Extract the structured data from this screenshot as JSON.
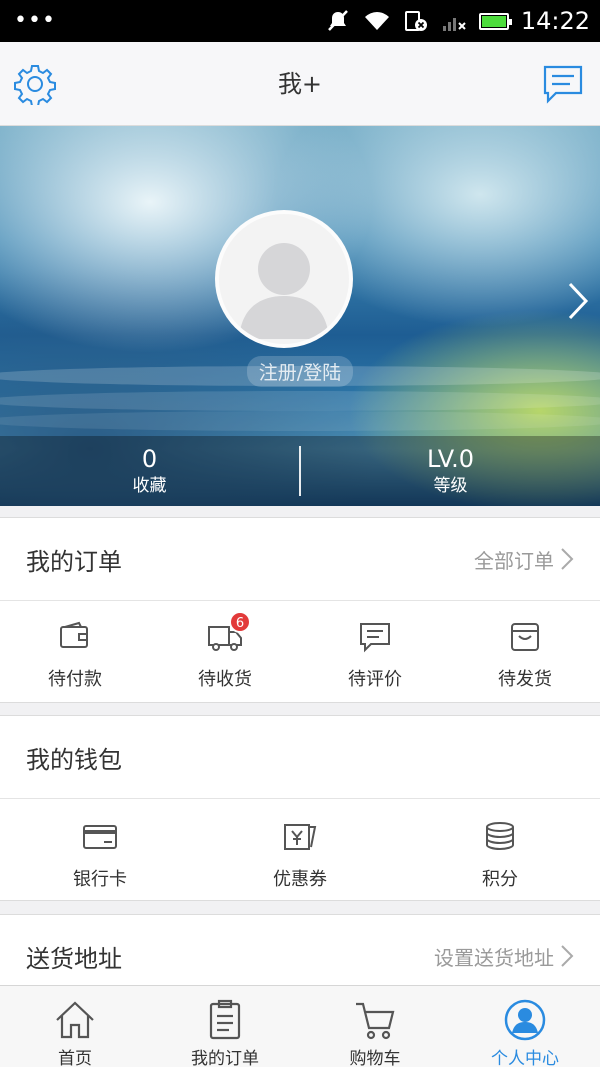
{
  "status_bar": {
    "time": "14:22",
    "dots": "•••"
  },
  "header": {
    "title": "我+"
  },
  "profile": {
    "login_label": "注册/登陆",
    "stats": [
      {
        "value": "0",
        "label": "收藏"
      },
      {
        "value": "LV.0",
        "label": "等级"
      }
    ]
  },
  "orders": {
    "title": "我的订单",
    "more": "全部订单",
    "items": [
      {
        "label": "待付款",
        "icon": "wallet-icon"
      },
      {
        "label": "待收货",
        "icon": "truck-icon",
        "badge": "6"
      },
      {
        "label": "待评价",
        "icon": "comment-icon"
      },
      {
        "label": "待发货",
        "icon": "box-icon"
      }
    ]
  },
  "wallet": {
    "title": "我的钱包",
    "items": [
      {
        "label": "银行卡",
        "icon": "bank-card-icon"
      },
      {
        "label": "优惠券",
        "icon": "coupon-icon"
      },
      {
        "label": "积分",
        "icon": "coins-icon"
      }
    ]
  },
  "address": {
    "title": "送货地址",
    "more": "设置送货地址"
  },
  "tabbar": {
    "active": 3,
    "tabs": [
      {
        "label": "首页",
        "icon": "home-icon"
      },
      {
        "label": "我的订单",
        "icon": "clipboard-icon"
      },
      {
        "label": "购物车",
        "icon": "cart-icon"
      },
      {
        "label": "个人中心",
        "icon": "user-icon"
      }
    ]
  },
  "colors": {
    "accent": "#2a8be0",
    "badge": "#e23a3a",
    "battery": "#4ddc3c"
  }
}
